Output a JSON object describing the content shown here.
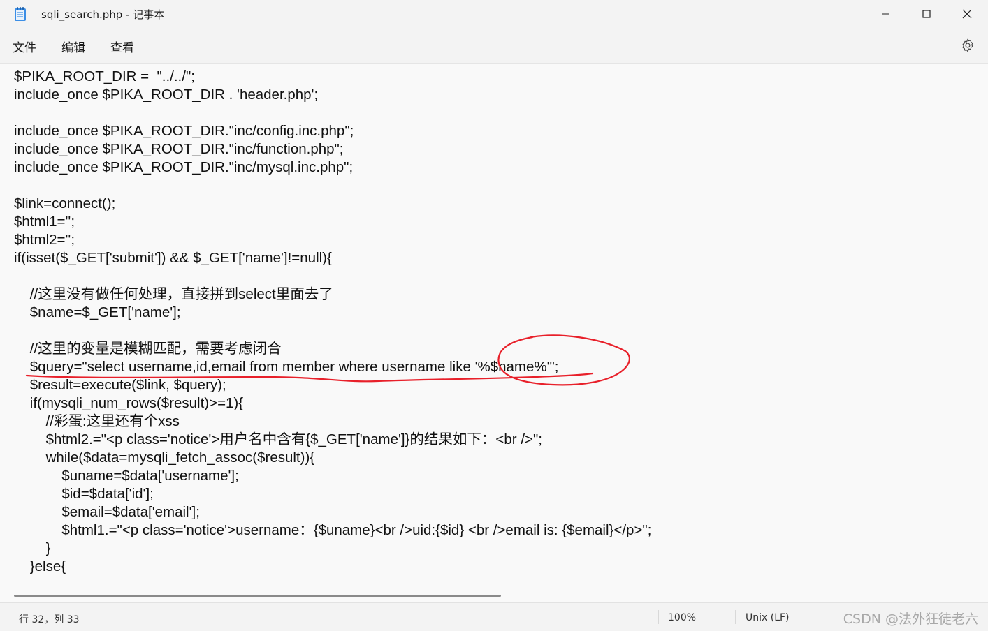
{
  "window": {
    "title": "sqli_search.php - 记事本",
    "minimize_icon": "minimize-icon",
    "maximize_icon": "maximize-icon",
    "close_icon": "close-icon"
  },
  "menu": {
    "file": "文件",
    "edit": "编辑",
    "view": "查看",
    "settings_icon": "gear-icon"
  },
  "editor": {
    "lines": [
      "$PIKA_ROOT_DIR =  \"../../\";",
      "include_once $PIKA_ROOT_DIR . 'header.php';",
      "",
      "include_once $PIKA_ROOT_DIR.\"inc/config.inc.php\";",
      "include_once $PIKA_ROOT_DIR.\"inc/function.php\";",
      "include_once $PIKA_ROOT_DIR.\"inc/mysql.inc.php\";",
      "",
      "$link=connect();",
      "$html1='';",
      "$html2='';",
      "if(isset($_GET['submit']) && $_GET['name']!=null){",
      "",
      "    //这里没有做任何处理，直接拼到select里面去了",
      "    $name=$_GET['name'];",
      "",
      "    //这里的变量是模糊匹配，需要考虑闭合",
      "    $query=\"select username,id,email from member where username like '%$name%'\";",
      "    $result=execute($link, $query);",
      "    if(mysqli_num_rows($result)>=1){",
      "        //彩蛋:这里还有个xss",
      "        $html2.=\"<p class='notice'>用户名中含有{$_GET['name']}的结果如下：<br />\";",
      "        while($data=mysqli_fetch_assoc($result)){",
      "            $uname=$data['username'];",
      "            $id=$data['id'];",
      "            $email=$data['email'];",
      "            $html1.=\"<p class='notice'>username：{$uname}<br />uid:{$id} <br />email is: {$email}</p>\";",
      "        }",
      "    }else{"
    ]
  },
  "status": {
    "position": "行 32，列 33",
    "zoom": "100%",
    "line_ending": "Unix (LF)",
    "watermark": "CSDN @法外狂徒老六"
  },
  "colors": {
    "annotation": "#e8202a",
    "background": "#f9f9f9",
    "chrome": "#f3f3f3"
  }
}
